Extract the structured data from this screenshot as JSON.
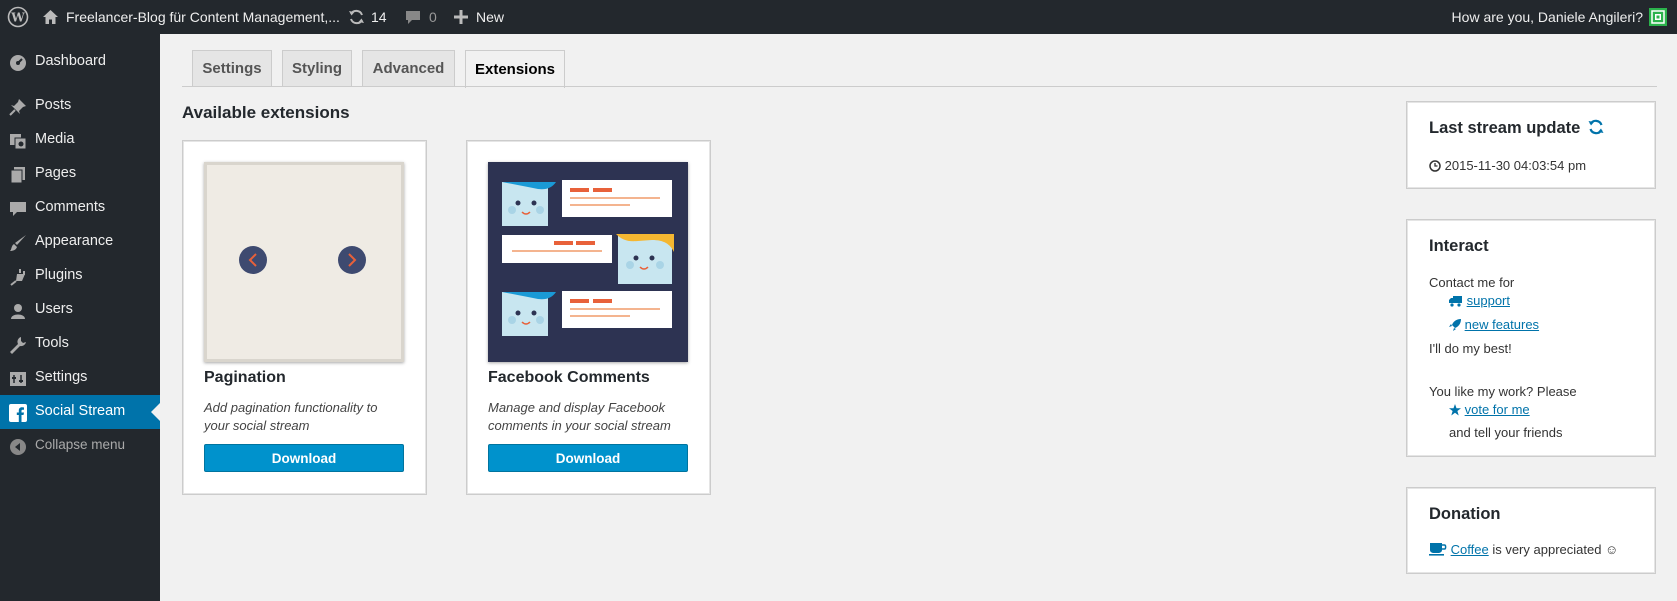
{
  "admin_bar": {
    "site_name": "Freelancer-Blog für Content Management,...",
    "updates_count": "14",
    "comments_count": "0",
    "new_label": "New",
    "greeting": "How are you, Daniele Angileri?"
  },
  "sidebar": {
    "items": [
      {
        "label": "Dashboard",
        "icon": "dashboard-icon"
      },
      {
        "label": "Posts",
        "icon": "pin-icon"
      },
      {
        "label": "Media",
        "icon": "media-icon"
      },
      {
        "label": "Pages",
        "icon": "pages-icon"
      },
      {
        "label": "Comments",
        "icon": "comment-icon"
      },
      {
        "label": "Appearance",
        "icon": "brush-icon"
      },
      {
        "label": "Plugins",
        "icon": "plug-icon"
      },
      {
        "label": "Users",
        "icon": "user-icon"
      },
      {
        "label": "Tools",
        "icon": "wrench-icon"
      },
      {
        "label": "Settings",
        "icon": "settings-icon"
      },
      {
        "label": "Social Stream",
        "icon": "facebook-icon",
        "active": true
      }
    ],
    "collapse_label": "Collapse menu"
  },
  "tabs": [
    {
      "label": "Settings"
    },
    {
      "label": "Styling"
    },
    {
      "label": "Advanced"
    },
    {
      "label": "Extensions",
      "active": true
    }
  ],
  "main": {
    "heading": "Available extensions",
    "extensions": [
      {
        "title": "Pagination",
        "description": "Add pagination functionality to your social stream",
        "button": "Download"
      },
      {
        "title": "Facebook Comments",
        "description": "Manage and display Facebook comments in your social stream",
        "button": "Download"
      }
    ]
  },
  "widgets": {
    "last_update": {
      "title": "Last stream update",
      "timestamp": "2015-11-30 04:03:54 pm"
    },
    "interact": {
      "title": "Interact",
      "contact_text": "Contact me for",
      "support_link": "support",
      "features_link": "new features",
      "best_text": "I'll do my best!",
      "like_text": "You like my work? Please",
      "vote_link": "vote for me",
      "tell_text": "and tell your friends"
    },
    "donation": {
      "title": "Donation",
      "coffee_link": "Coffee",
      "appreciated_text": "is very appreciated ☺"
    }
  },
  "colors": {
    "admin_dark": "#23282d",
    "accent_blue": "#0073aa",
    "button_blue": "#0092cc",
    "background": "#f1f1f1"
  }
}
